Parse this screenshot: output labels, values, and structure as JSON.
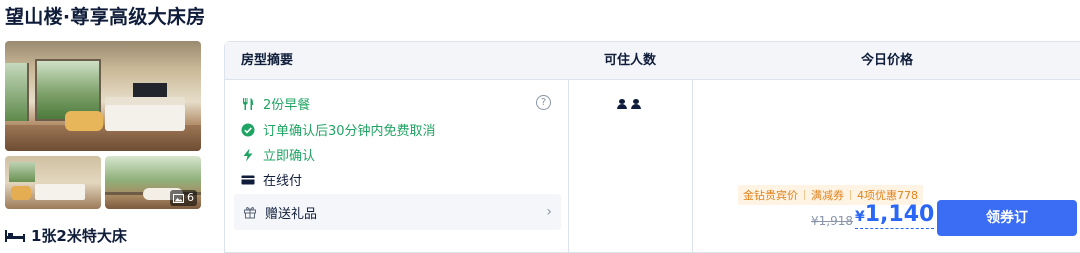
{
  "room": {
    "title": "望山楼·尊享高级大床房",
    "photo_count": "6",
    "bed": "1张2米特大床"
  },
  "table": {
    "headers": {
      "summary": "房型摘要",
      "guests": "可住人数",
      "price": "今日价格"
    },
    "features": [
      {
        "icon": "utensils-icon",
        "text": "2份早餐",
        "color": "#20a463"
      },
      {
        "icon": "check-circle-icon",
        "text": "订单确认后30分钟内免费取消",
        "color": "#20a463"
      },
      {
        "icon": "lightning-icon",
        "text": "立即确认",
        "color": "#20a463"
      },
      {
        "icon": "credit-card-icon",
        "text": "在线付",
        "color": "#0f1d3a"
      }
    ],
    "info_icon_glyph": "?",
    "gift": {
      "label": "赠送礼品",
      "chevron": "›"
    },
    "guest_count": 2
  },
  "offer": {
    "promos": [
      "金钻贵宾价",
      "满减券",
      "4项优惠778"
    ],
    "original_price": "¥1,918",
    "currency": "¥",
    "price": "1,140",
    "book_label": "领券订"
  },
  "colors": {
    "accent_blue": "#2b67f6",
    "button_blue": "#3a6df4",
    "green": "#20a463",
    "promo_orange": "#e0831f"
  }
}
